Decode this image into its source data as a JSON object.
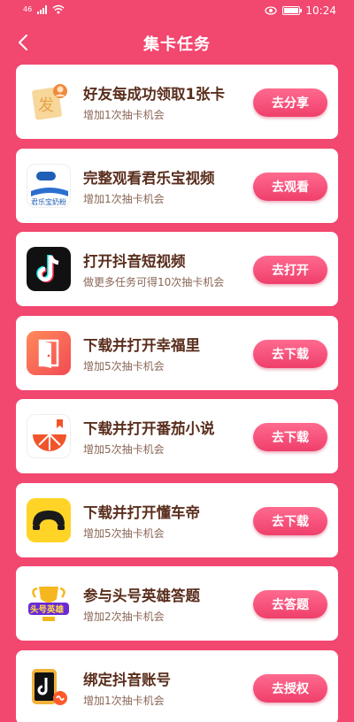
{
  "status": {
    "signal_label": "46",
    "time": "10:24"
  },
  "nav": {
    "title": "集卡任务",
    "back_icon": "chevron-left-icon"
  },
  "colors": {
    "background": "#f2476f",
    "button": "#ef3f6b",
    "title_text": "#5a2e1d"
  },
  "tasks": [
    {
      "title": "好友每成功领取1张卡",
      "subtitle": "增加1次抽卡机会",
      "button": "去分享",
      "icon": "friend-card-icon",
      "icon_text": "发"
    },
    {
      "title": "完整观看君乐宝视频",
      "subtitle": "增加1次抽卡机会",
      "button": "去观看",
      "icon": "junlebao-logo-icon",
      "icon_text": "君乐宝奶粉"
    },
    {
      "title": "打开抖音短视频",
      "subtitle": "做更多任务可得10次抽卡机会",
      "button": "去打开",
      "icon": "douyin-logo-icon"
    },
    {
      "title": "下载并打开幸福里",
      "subtitle": "增加5次抽卡机会",
      "button": "去下载",
      "icon": "xingfuli-door-icon"
    },
    {
      "title": "下载并打开番茄小说",
      "subtitle": "增加5次抽卡机会",
      "button": "去下载",
      "icon": "tomato-novel-icon"
    },
    {
      "title": "下载并打开懂车帝",
      "subtitle": "增加5次抽卡机会",
      "button": "去下载",
      "icon": "dongchedi-wheel-icon"
    },
    {
      "title": "参与头号英雄答题",
      "subtitle": "增加2次抽卡机会",
      "button": "去答题",
      "icon": "hero-quiz-trophy-icon",
      "icon_text": "头号英雄"
    },
    {
      "title": "绑定抖音账号",
      "subtitle": "增加1次抽卡机会",
      "button": "去授权",
      "icon": "douyin-bind-icon"
    }
  ]
}
